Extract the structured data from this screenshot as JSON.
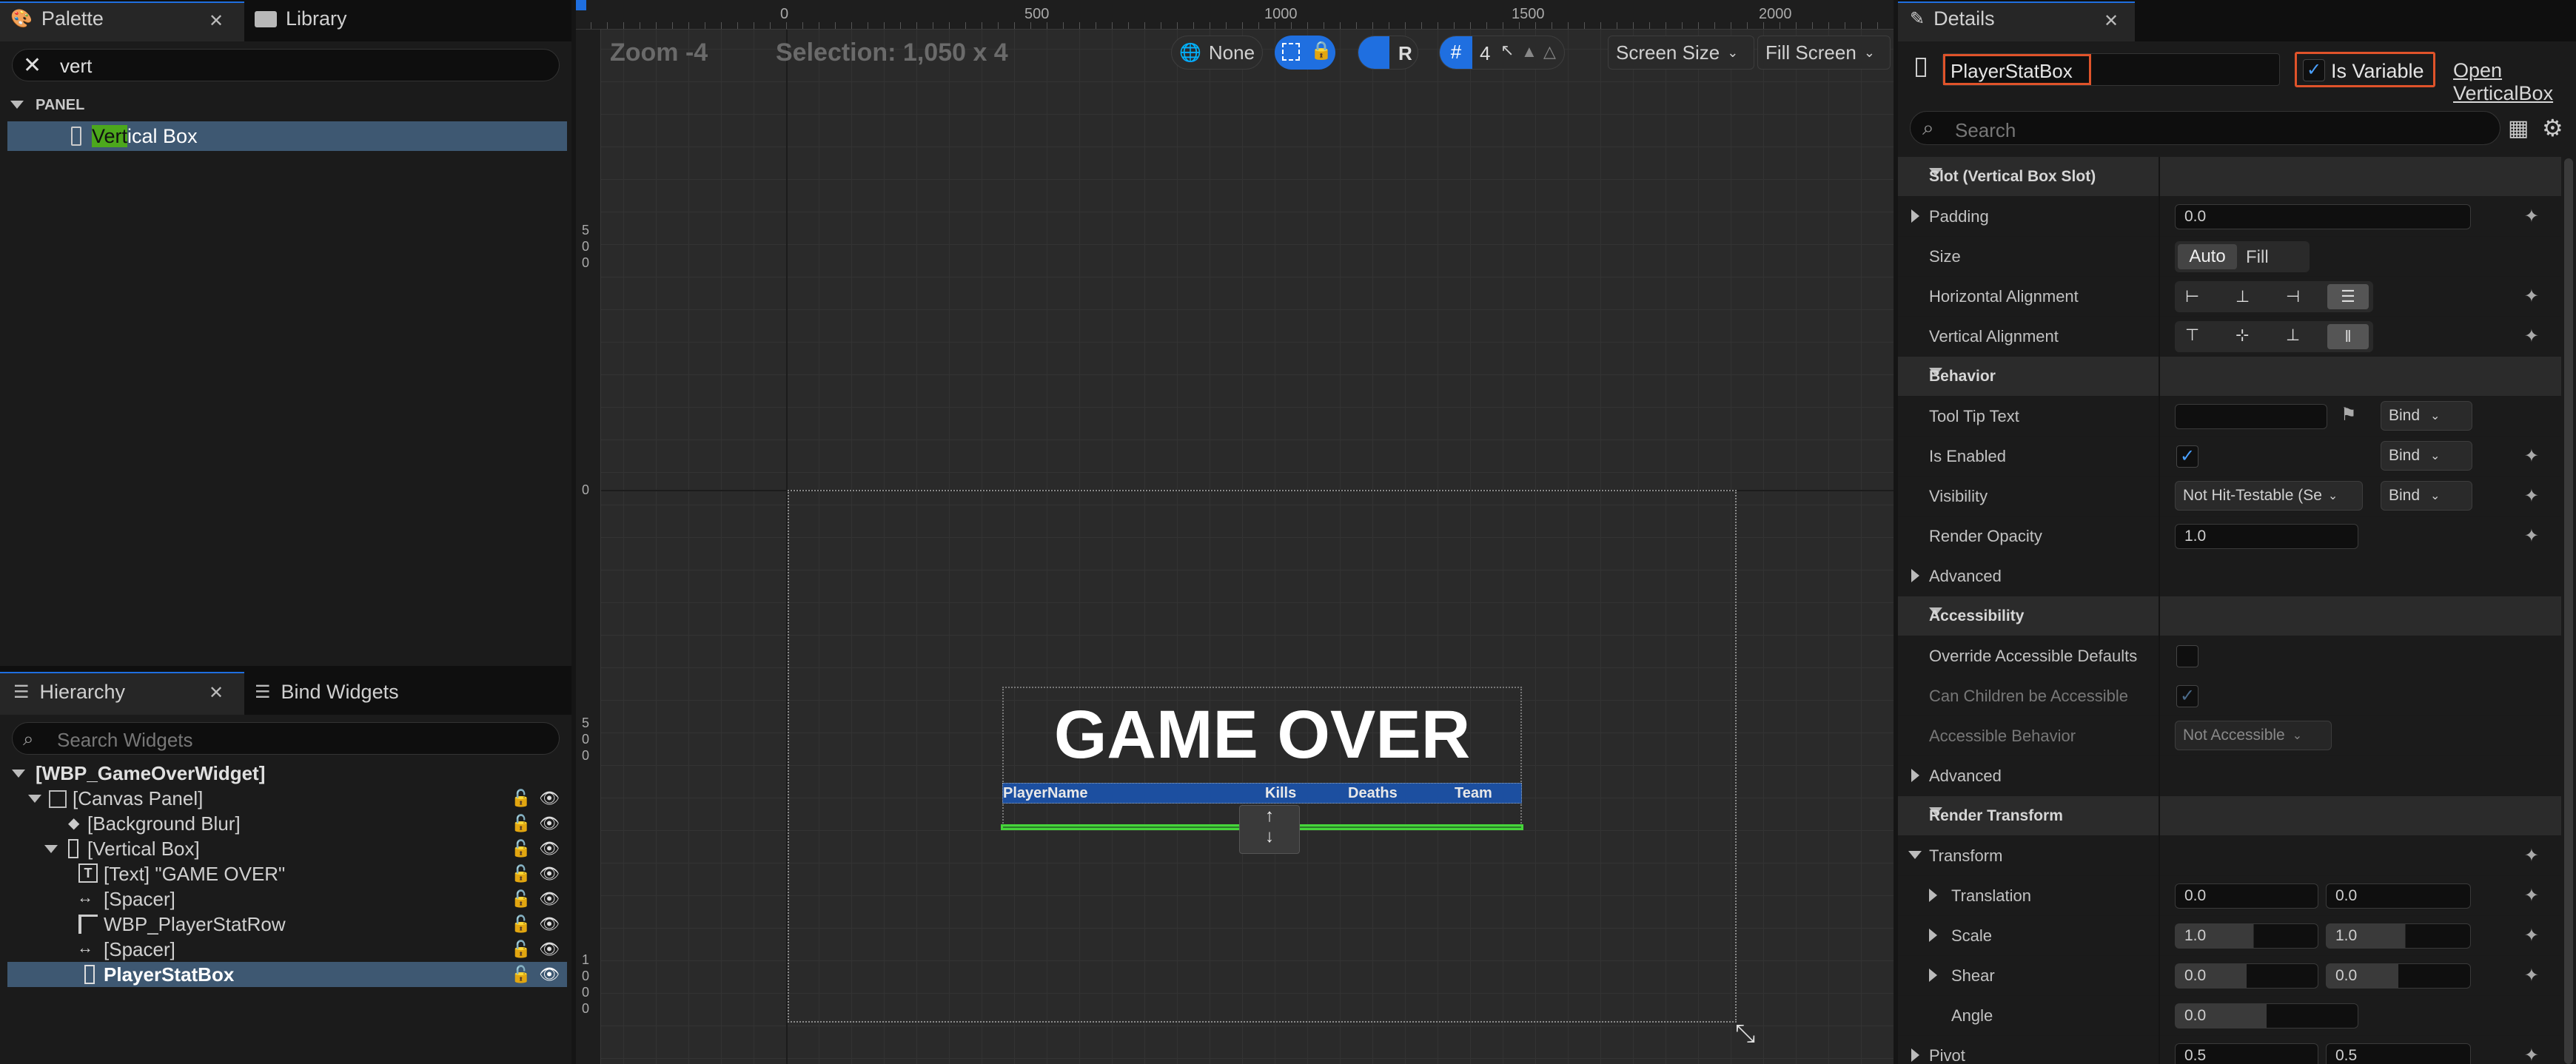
{
  "palette": {
    "tab_label": "Palette",
    "library_label": "Library",
    "search_value": "vert",
    "category": "PANEL",
    "item_match": "Vert",
    "item_rest": "ical Box"
  },
  "hierarchy": {
    "tab_label": "Hierarchy",
    "bind_tab_label": "Bind Widgets",
    "search_placeholder": "Search Widgets",
    "root": "[WBP_GameOverWidget]",
    "nodes": [
      {
        "label": "[Canvas Panel]"
      },
      {
        "label": "[Background Blur]"
      },
      {
        "label": "[Vertical Box]"
      },
      {
        "label": "[Text] \"GAME OVER\""
      },
      {
        "label": "[Spacer]"
      },
      {
        "label": "WBP_PlayerStatRow"
      },
      {
        "label": "[Spacer]"
      },
      {
        "label": "PlayerStatBox"
      }
    ]
  },
  "viewport": {
    "zoom": "Zoom -4",
    "selection": "Selection: 1,050 x 4",
    "none_label": "None",
    "r_label": "R",
    "grid_value": "4",
    "screen_size": "Screen Size",
    "fill_screen": "Fill Screen",
    "ruler_top": [
      "0",
      "500",
      "1000",
      "1500",
      "2000"
    ],
    "ruler_left": [
      "5\n0\n0",
      "0",
      "5\n0\n0",
      "1\n0\n0\n0"
    ],
    "title_text": "GAME OVER",
    "columns": [
      "PlayerName",
      "Kills",
      "Deaths",
      "Team"
    ]
  },
  "details": {
    "tab_label": "Details",
    "name_value": "PlayerStatBox",
    "is_variable_label": "Is Variable",
    "open_label": "Open VerticalBox",
    "search_placeholder": "Search",
    "sections": {
      "slot": "Slot (Vertical Box Slot)",
      "behavior": "Behavior",
      "accessibility": "Accessibility",
      "render_transform": "Render Transform"
    },
    "padding_label": "Padding",
    "padding_value": "0.0",
    "size_label": "Size",
    "size_auto": "Auto",
    "size_fill": "Fill",
    "halign_label": "Horizontal Alignment",
    "valign_label": "Vertical Alignment",
    "tooltip_label": "Tool Tip Text",
    "bind_label": "Bind",
    "enabled_label": "Is Enabled",
    "visibility_label": "Visibility",
    "visibility_value": "Not Hit-Testable (Se",
    "opacity_label": "Render Opacity",
    "opacity_value": "1.0",
    "advanced_label": "Advanced",
    "override_label": "Override Accessible Defaults",
    "children_label": "Can Children be Accessible",
    "acc_behavior_label": "Accessible Behavior",
    "acc_behavior_value": "Not Accessible",
    "transform_label": "Transform",
    "translation_label": "Translation",
    "translation_x": "0.0",
    "translation_y": "0.0",
    "scale_label": "Scale",
    "scale_x": "1.0",
    "scale_y": "1.0",
    "shear_label": "Shear",
    "shear_x": "0.0",
    "shear_y": "0.0",
    "angle_label": "Angle",
    "angle_value": "0.0",
    "pivot_label": "Pivot",
    "pivot_x": "0.5",
    "pivot_y": "0.5"
  },
  "colors": {
    "accent": "#1f6fe0",
    "selection_row": "#3e5872",
    "highlight": "#e0532a",
    "green": "#46d63a",
    "match": "#4ca81c"
  }
}
